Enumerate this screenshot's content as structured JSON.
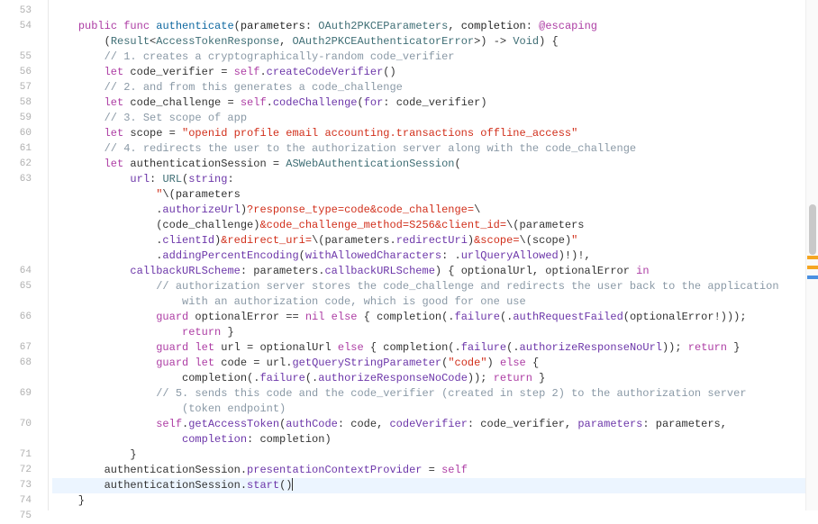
{
  "gutter": {
    "lines": [
      "53",
      "54",
      "",
      "55",
      "56",
      "57",
      "58",
      "59",
      "60",
      "61",
      "62",
      "63",
      "",
      "",
      "",
      "",
      "",
      "64",
      "65",
      "",
      "66",
      "",
      "67",
      "68",
      "",
      "69",
      "",
      "70",
      "",
      "71",
      "72",
      "73",
      "74",
      "75"
    ]
  },
  "colors": {
    "keyword": "#ad3da4",
    "type": "#3f6e75",
    "string": "#d12f1b",
    "comment": "#8a99a6",
    "method": "#6c36a9",
    "declaration": "#0f68a0",
    "background": "#ffffff",
    "current_line": "#ecf5ff",
    "marker_orange": "#f5a623",
    "marker_blue": "#4a90e2"
  },
  "scrollbar": {
    "thumb_top_pct": 40,
    "thumb_height_pct": 10,
    "markers": [
      {
        "color": "#f5a623",
        "top_pct": 50
      },
      {
        "color": "#f5a623",
        "top_pct": 52
      },
      {
        "color": "#4a90e2",
        "top_pct": 54
      }
    ]
  },
  "chart_data": {
    "type": "table",
    "note": "Source code lines; line_number null = soft-wrap continuation of previous numbered line",
    "columns": [
      "line_number",
      "text"
    ],
    "rows": [
      [
        53,
        ""
      ],
      [
        54,
        "    public func authenticate(parameters: OAuth2PKCEParameters, completion: @escaping"
      ],
      [
        null,
        "        (Result<AccessTokenResponse, OAuth2PKCEAuthenticatorError>) -> Void) {"
      ],
      [
        55,
        "        // 1. creates a cryptographically-random code_verifier"
      ],
      [
        56,
        "        let code_verifier = self.createCodeVerifier()"
      ],
      [
        57,
        "        // 2. and from this generates a code_challenge"
      ],
      [
        58,
        "        let code_challenge = self.codeChallenge(for: code_verifier)"
      ],
      [
        59,
        "        // 3. Set scope of app"
      ],
      [
        60,
        "        let scope = \"openid profile email accounting.transactions offline_access\""
      ],
      [
        61,
        "        // 4. redirects the user to the authorization server along with the code_challenge"
      ],
      [
        62,
        "        let authenticationSession = ASWebAuthenticationSession("
      ],
      [
        63,
        "            url: URL(string:"
      ],
      [
        null,
        "                \"\\(parameters"
      ],
      [
        null,
        "                .authorizeUrl)?response_type=code&code_challenge=\\"
      ],
      [
        null,
        "                (code_challenge)&code_challenge_method=S256&client_id=\\(parameters"
      ],
      [
        null,
        "                .clientId)&redirect_uri=\\(parameters.redirectUri)&scope=\\(scope)\""
      ],
      [
        null,
        "                .addingPercentEncoding(withAllowedCharacters: .urlQueryAllowed)!)!,"
      ],
      [
        64,
        "            callbackURLScheme: parameters.callbackURLScheme) { optionalUrl, optionalError in"
      ],
      [
        65,
        "                // authorization server stores the code_challenge and redirects the user back to the application"
      ],
      [
        null,
        "                    with an authorization code, which is good for one use"
      ],
      [
        66,
        "                guard optionalError == nil else { completion(.failure(.authRequestFailed(optionalError!)));"
      ],
      [
        null,
        "                    return }"
      ],
      [
        67,
        "                guard let url = optionalUrl else { completion(.failure(.authorizeResponseNoUrl)); return }"
      ],
      [
        68,
        "                guard let code = url.getQueryStringParameter(\"code\") else {"
      ],
      [
        null,
        "                    completion(.failure(.authorizeResponseNoCode)); return }"
      ],
      [
        69,
        "                // 5. sends this code and the code_verifier (created in step 2) to the authorization server"
      ],
      [
        null,
        "                    (token endpoint)"
      ],
      [
        70,
        "                self.getAccessToken(authCode: code, codeVerifier: code_verifier, parameters: parameters,"
      ],
      [
        null,
        "                    completion: completion)"
      ],
      [
        71,
        "            }"
      ],
      [
        72,
        "        authenticationSession.presentationContextProvider = self"
      ],
      [
        73,
        "        authenticationSession.start()"
      ],
      [
        74,
        "    }"
      ],
      [
        75,
        ""
      ]
    ]
  },
  "code_html": [
    "",
    "    <span class='kw'>public</span> <span class='kw'>func</span> <span class='fn-decl'>authenticate</span>(<span class='plain'>parameters</span>: <span class='type'>OAuth2PKCEParameters</span>, <span class='plain'>completion</span>: <span class='attr'>@escaping</span>",
    "        (<span class='type'>Result</span>&lt;<span class='type'>AccessTokenResponse</span>, <span class='type'>OAuth2PKCEAuthenticatorError</span>&gt;) -&gt; <span class='type'>Void</span>) {",
    "        <span class='cmt'>// 1. creates a cryptographically-random code_verifier</span>",
    "        <span class='kw'>let</span> code_verifier = <span class='kw'>self</span>.<span class='method'>createCodeVerifier</span>()",
    "        <span class='cmt'>// 2. and from this generates a code_challenge</span>",
    "        <span class='kw'>let</span> code_challenge = <span class='kw'>self</span>.<span class='method'>codeChallenge</span>(<span class='param'>for</span>: code_verifier)",
    "        <span class='cmt'>// 3. Set scope of app</span>",
    "        <span class='kw'>let</span> scope = <span class='str'>\"openid profile email accounting.transactions offline_access\"</span>",
    "        <span class='cmt'>// 4. redirects the user to the authorization server along with the code_challenge</span>",
    "        <span class='kw'>let</span> authenticationSession = <span class='type'>ASWebAuthenticationSession</span>(",
    "            <span class='param'>url</span>: <span class='type'>URL</span>(<span class='param'>string</span>:",
    "                <span class='str'>\"</span>\\(parameters",
    "                .<span class='prop'>authorizeUrl</span>)<span class='str'>?response_type=code&amp;code_challenge=</span>\\",
    "                (code_challenge)<span class='str'>&amp;code_challenge_method=S256&amp;client_id=</span>\\(parameters",
    "                .<span class='prop'>clientId</span>)<span class='str'>&amp;redirect_uri=</span>\\(parameters.<span class='prop'>redirectUri</span>)<span class='str'>&amp;scope=</span>\\(scope)<span class='str'>\"</span>",
    "                .<span class='method'>addingPercentEncoding</span>(<span class='param'>withAllowedCharacters</span>: .<span class='enumc'>urlQueryAllowed</span>)!)!,",
    "            <span class='param'>callbackURLScheme</span>: parameters.<span class='prop'>callbackURLScheme</span>) { optionalUrl, optionalError <span class='kw'>in</span>",
    "                <span class='cmt'>// authorization server stores the code_challenge and redirects the user back to the application</span>",
    "<span class='cmt'>                    with an authorization code, which is good for one use</span>",
    "                <span class='kw'>guard</span> optionalError == <span class='kw'>nil</span> <span class='kw'>else</span> { completion(.<span class='enumc'>failure</span>(.<span class='enumc'>authRequestFailed</span>(optionalError!)));",
    "                    <span class='kw'>return</span> }",
    "                <span class='kw'>guard</span> <span class='kw'>let</span> url = optionalUrl <span class='kw'>else</span> { completion(.<span class='enumc'>failure</span>(.<span class='enumc'>authorizeResponseNoUrl</span>)); <span class='kw'>return</span> }",
    "                <span class='kw'>guard</span> <span class='kw'>let</span> code = url.<span class='method'>getQueryStringParameter</span>(<span class='str'>\"code\"</span>) <span class='kw'>else</span> {",
    "                    completion(.<span class='enumc'>failure</span>(.<span class='enumc'>authorizeResponseNoCode</span>)); <span class='kw'>return</span> }",
    "                <span class='cmt'>// 5. sends this code and the code_verifier (created in step 2) to the authorization server</span>",
    "<span class='cmt'>                    (token endpoint)</span>",
    "                <span class='kw'>self</span>.<span class='method'>getAccessToken</span>(<span class='param'>authCode</span>: code, <span class='param'>codeVerifier</span>: code_verifier, <span class='param'>parameters</span>: parameters,",
    "                    <span class='param'>completion</span>: completion)",
    "            }",
    "        authenticationSession.<span class='prop'>presentationContextProvider</span> = <span class='kw'>self</span>",
    "        authenticationSession.<span class='method'>start</span>()<span class='caret'></span>",
    "    }",
    ""
  ],
  "current_line_index": 31
}
